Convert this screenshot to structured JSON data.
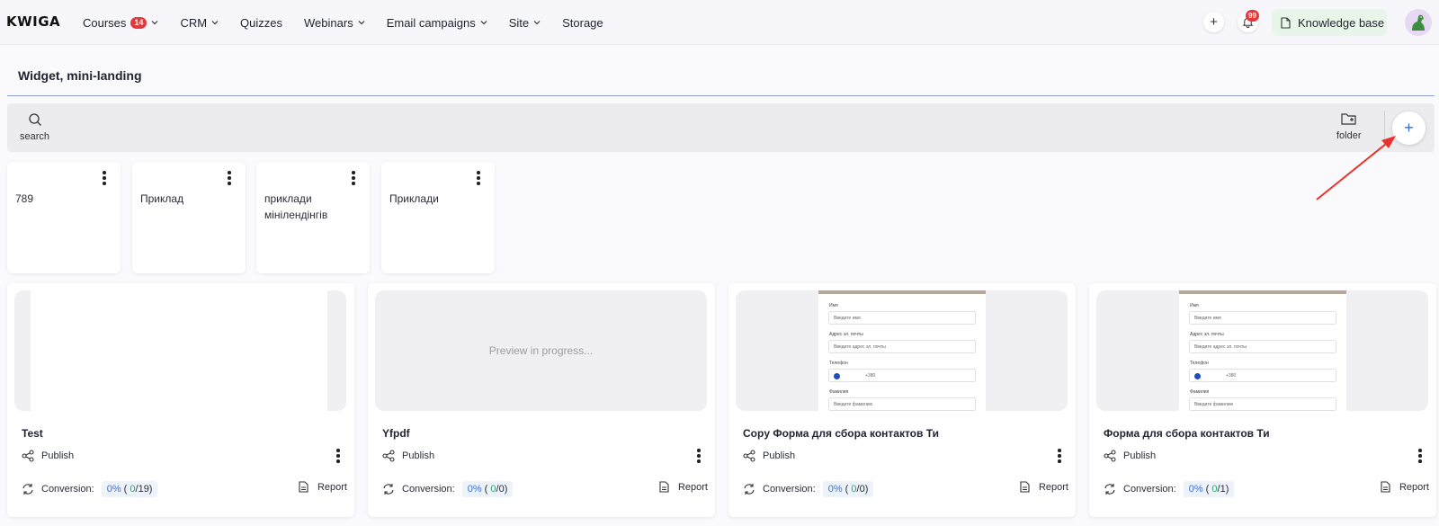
{
  "app": {
    "logo": "KWIGA"
  },
  "nav": {
    "items": [
      {
        "label": "Courses",
        "badge": "14",
        "dropdown": true
      },
      {
        "label": "CRM",
        "dropdown": true
      },
      {
        "label": "Quizzes",
        "dropdown": false
      },
      {
        "label": "Webinars",
        "dropdown": true
      },
      {
        "label": "Email campaigns",
        "dropdown": true
      },
      {
        "label": "Site",
        "dropdown": true
      },
      {
        "label": "Storage",
        "dropdown": false
      }
    ],
    "plus_label": "+",
    "notifications_badge": "99",
    "knowledge_base_label": "Knowledge base"
  },
  "page": {
    "title": "Widget, mini-landing"
  },
  "toolbar": {
    "search_label": "search",
    "folder_label": "folder",
    "add_label": "+"
  },
  "folders": [
    {
      "name": "789"
    },
    {
      "name": "Приклад"
    },
    {
      "name": "приклади мінілендінгів"
    },
    {
      "name": "Приклади"
    }
  ],
  "form_preview": {
    "name_label": "Имя",
    "name_placeholder": "Введите имя",
    "email_label": "Адрес эл. почты",
    "email_placeholder": "Введите адрес эл. почты",
    "phone_label": "Телефон",
    "phone_value": "+380",
    "surname_label": "Фамилия",
    "surname_placeholder": "Введите фамилию"
  },
  "widgets": [
    {
      "title": "Test",
      "preview": "blank",
      "publish_label": "Publish",
      "conversion_label": "Conversion:",
      "conv_pct": "0%",
      "conv_num": "0",
      "conv_total": "/19)",
      "report_label": "Report"
    },
    {
      "title": "Yfpdf",
      "preview": "progress",
      "preview_text": "Preview in progress...",
      "publish_label": "Publish",
      "conversion_label": "Conversion:",
      "conv_pct": "0%",
      "conv_num": "0",
      "conv_total": "/0)",
      "report_label": "Report"
    },
    {
      "title": "Copy Форма для сбора контактов Ти",
      "preview": "form",
      "publish_label": "Publish",
      "conversion_label": "Conversion:",
      "conv_pct": "0%",
      "conv_num": "0",
      "conv_total": "/0)",
      "report_label": "Report"
    },
    {
      "title": "Форма для сбора контактов Ти",
      "preview": "form",
      "publish_label": "Publish",
      "conversion_label": "Conversion:",
      "conv_pct": "0%",
      "conv_num": "0",
      "conv_total": "/1)",
      "report_label": "Report"
    }
  ],
  "colors": {
    "accent": "#3b6fd8",
    "badge": "#e5383b",
    "annotation_arrow": "#e8322b"
  }
}
